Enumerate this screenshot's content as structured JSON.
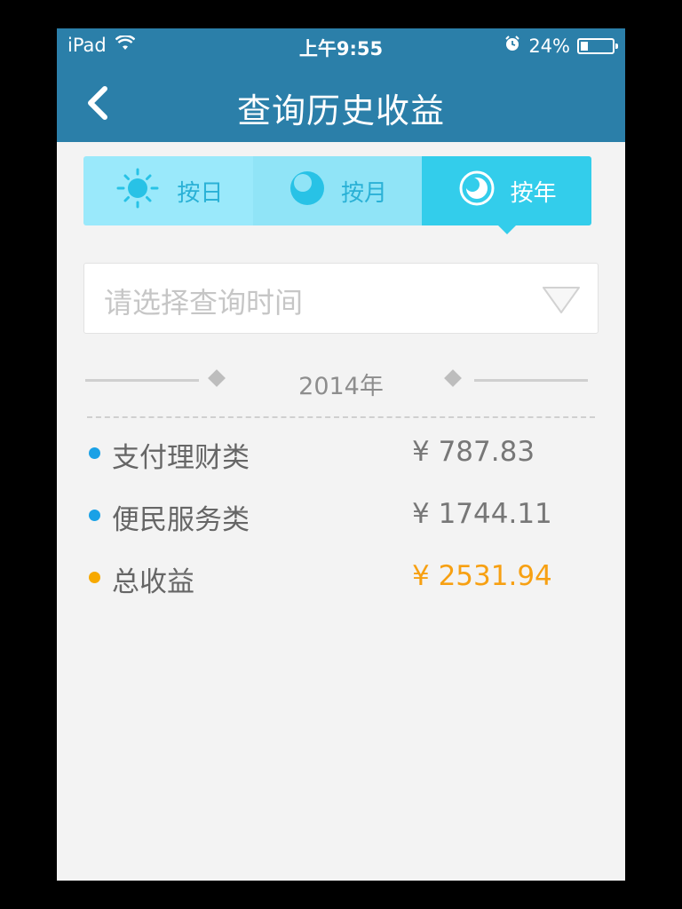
{
  "status_bar": {
    "device": "iPad",
    "time": "上午9:55",
    "battery": "24%",
    "battery_level": 0.24
  },
  "nav": {
    "title": "查询历史收益"
  },
  "segments": [
    {
      "label": "按日",
      "icon": "sun-icon",
      "selected": false
    },
    {
      "label": "按月",
      "icon": "moon-icon",
      "selected": false
    },
    {
      "label": "按年",
      "icon": "year-circle-icon",
      "selected": true
    }
  ],
  "time_select": {
    "placeholder": "请选择查询时间"
  },
  "year_header": "2014年",
  "rows": [
    {
      "label": "支付理财类",
      "value": "¥ 787.83",
      "dot_color": "#1aa1e6",
      "value_color": "#777777"
    },
    {
      "label": "便民服务类",
      "value": "¥ 1744.11",
      "dot_color": "#1aa1e6",
      "value_color": "#777777"
    },
    {
      "label": "总收益",
      "value": "¥ 2531.94",
      "dot_color": "#f7a900",
      "value_color": "#f7a012"
    }
  ],
  "colors": {
    "nav_bg": "#2b7fa9",
    "segment_selected": "#33cdeb",
    "accent_orange": "#f7a012"
  }
}
